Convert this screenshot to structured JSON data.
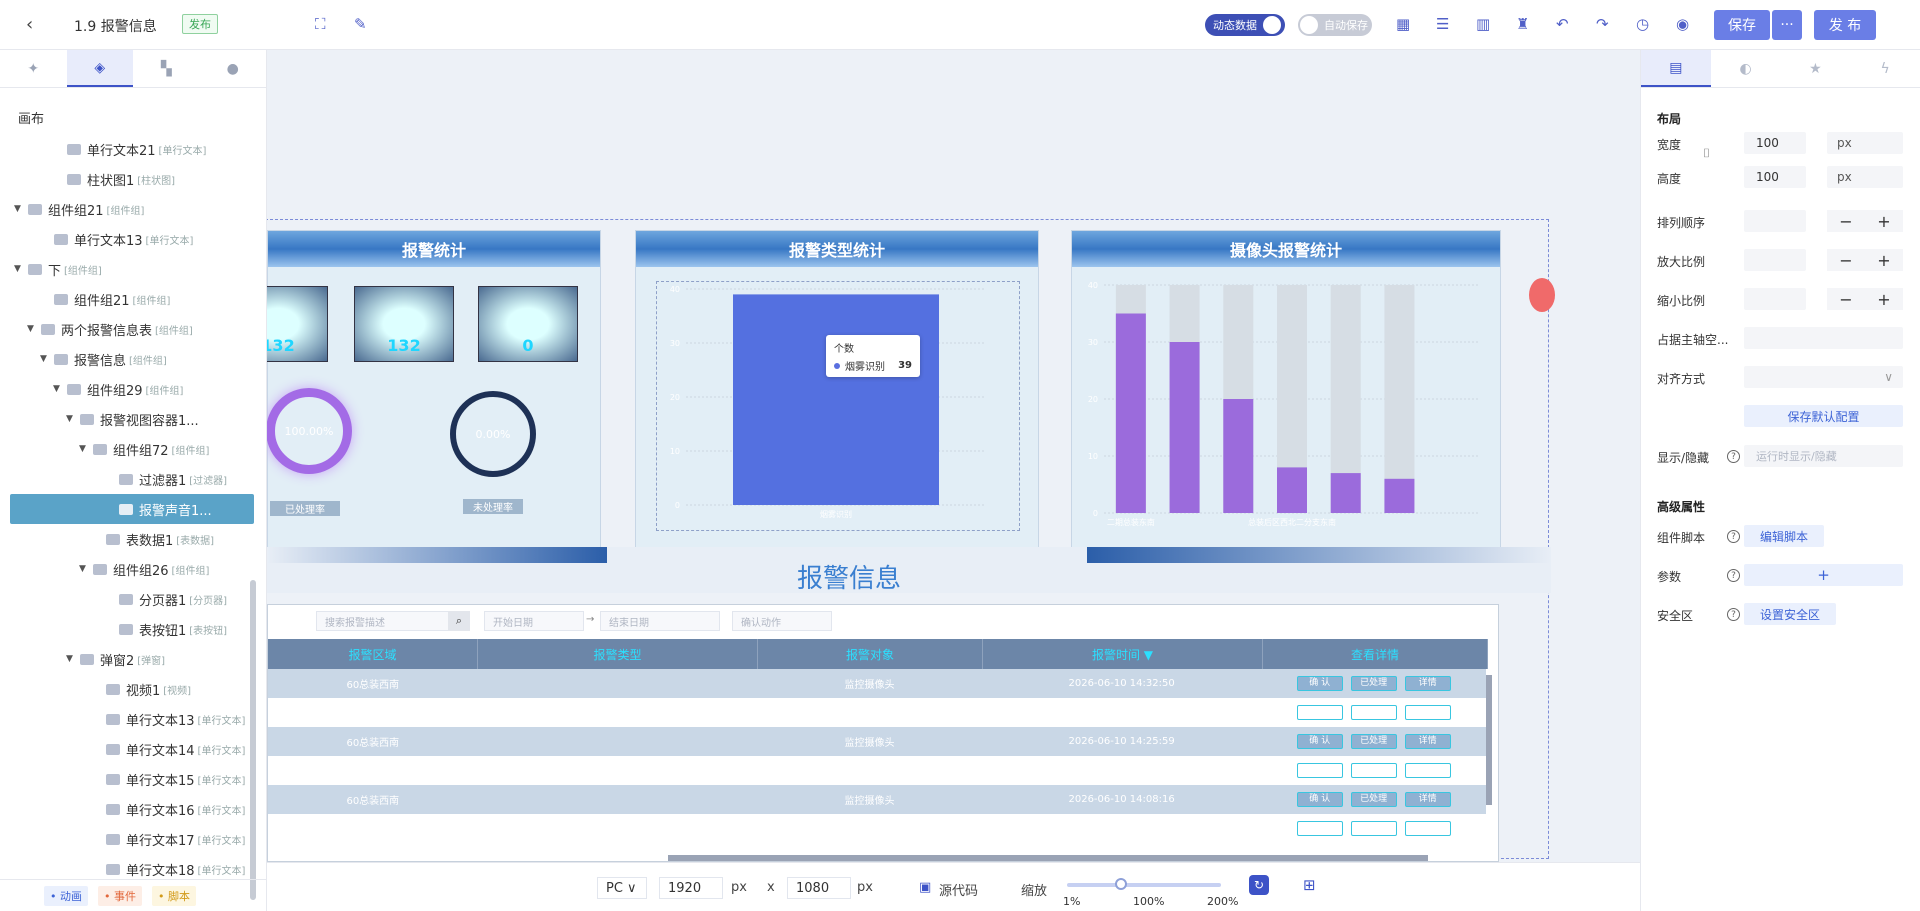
{
  "header": {
    "title": "1.9 报警信息",
    "badge": "发布",
    "dynamic_label": "动态数据",
    "autosave_label": "自动保存",
    "save": "保存",
    "more": "···",
    "publish": "发 布"
  },
  "left": {
    "canvas": "画布",
    "tree": [
      {
        "label": "单行文本21",
        "tag": "[单行文本]",
        "level": 3,
        "arrow": ""
      },
      {
        "label": "柱状图1",
        "tag": "[柱状图]",
        "level": 3,
        "arrow": ""
      },
      {
        "label": "组件组21",
        "tag": "[组件组]",
        "level": 0,
        "arrow": "▼"
      },
      {
        "label": "单行文本13",
        "tag": "[单行文本]",
        "level": 2,
        "arrow": ""
      },
      {
        "label": "下",
        "tag": "[组件组]",
        "level": 0,
        "arrow": "▼"
      },
      {
        "label": "组件组21",
        "tag": "[组件组]",
        "level": 2,
        "arrow": ""
      },
      {
        "label": "两个报警信息表",
        "tag": "[组件组]",
        "level": 1,
        "arrow": "▼"
      },
      {
        "label": "报警信息",
        "tag": "[组件组]",
        "level": 2,
        "arrow": "▼"
      },
      {
        "label": "组件组29",
        "tag": "[组件组]",
        "level": 3,
        "arrow": "▼"
      },
      {
        "label": "报警视图容器1...",
        "tag": "",
        "level": 4,
        "arrow": "▼"
      },
      {
        "label": "组件组72",
        "tag": "[组件组]",
        "level": 5,
        "arrow": "▼"
      },
      {
        "label": "过滤器1",
        "tag": "[过滤器]",
        "level": 7,
        "arrow": ""
      },
      {
        "label": "报警声音1...",
        "tag": "",
        "level": 7,
        "arrow": "",
        "selected": true
      },
      {
        "label": "表数据1",
        "tag": "[表数据]",
        "level": 6,
        "arrow": ""
      },
      {
        "label": "组件组26",
        "tag": "[组件组]",
        "level": 5,
        "arrow": "▼"
      },
      {
        "label": "分页器1",
        "tag": "[分页器]",
        "level": 7,
        "arrow": ""
      },
      {
        "label": "表按钮1",
        "tag": "[表按钮]",
        "level": 7,
        "arrow": ""
      },
      {
        "label": "弹窗2",
        "tag": "[弹窗]",
        "level": 4,
        "arrow": "▼"
      },
      {
        "label": "视频1",
        "tag": "[视频]",
        "level": 6,
        "arrow": ""
      },
      {
        "label": "单行文本13",
        "tag": "[单行文本]",
        "level": 6,
        "arrow": ""
      },
      {
        "label": "单行文本14",
        "tag": "[单行文本]",
        "level": 6,
        "arrow": ""
      },
      {
        "label": "单行文本15",
        "tag": "[单行文本]",
        "level": 6,
        "arrow": ""
      },
      {
        "label": "单行文本16",
        "tag": "[单行文本]",
        "level": 6,
        "arrow": ""
      },
      {
        "label": "单行文本17",
        "tag": "[单行文本]",
        "level": 6,
        "arrow": ""
      },
      {
        "label": "单行文本18",
        "tag": "[单行文本]",
        "level": 6,
        "arrow": ""
      }
    ],
    "footer": {
      "anim": "• 动画",
      "event": "• 事件",
      "script": "• 脚本"
    }
  },
  "stage": {
    "panel1_title": "报警统计",
    "panel2_title": "报警类型统计",
    "panel3_title": "摄像头报警统计",
    "counts": [
      "132",
      "132",
      "0"
    ],
    "ring1": "100.00%",
    "ring2": "0.00%",
    "ring1_label": "已处理率",
    "ring2_label": "未处理率",
    "tooltip_title": "个数",
    "tooltip_series": "烟雾识别",
    "tooltip_value": "39",
    "bar2_label": "烟雾识别",
    "info_title": "报警信息",
    "filter": {
      "desc": "搜索报警描述",
      "start": "开始日期",
      "arrow": "→",
      "end": "结束日期",
      "action": "确认动作"
    },
    "columns": [
      "报警区域",
      "报警类型",
      "报警对象",
      "报警时间 ▼",
      "查看详情"
    ],
    "rows": [
      {
        "area": "60总装西南",
        "obj": "监控摄像头",
        "time": "2026-06-10 14:32:50"
      },
      {
        "area": "60总装西南",
        "obj": "监控摄像头",
        "time": "2026-06-10 14:25:59"
      },
      {
        "area": "60总装西南",
        "obj": "监控摄像头",
        "time": "2026-06-10 14:08:16"
      }
    ],
    "btns": [
      "确 认",
      "已处理",
      "详情"
    ]
  },
  "chart_data": [
    {
      "type": "bar",
      "title": "报警类型统计",
      "categories": [
        "烟雾识别"
      ],
      "values": [
        39
      ],
      "ylim": [
        0,
        40
      ],
      "yticks": [
        "0",
        "10",
        "20",
        "30",
        "40"
      ]
    },
    {
      "type": "bar",
      "title": "摄像头报警统计",
      "categories": [
        "二期总装东南",
        "",
        "",
        "总装后区西北二分支东南",
        "",
        "",
        ""
      ],
      "values": [
        35,
        30,
        20,
        8,
        7,
        6
      ],
      "ylim": [
        0,
        40
      ],
      "yticks": [
        "0",
        "10",
        "20",
        "30",
        "40"
      ],
      "bar_color": "#9b6bdc",
      "bg_color": "#d6dde4"
    }
  ],
  "right": {
    "layout": "布局",
    "width": "宽度",
    "height": "高度",
    "w_val": "100",
    "h_val": "100",
    "unit": "px",
    "order": "排列顺序",
    "zoomin": "放大比例",
    "zoomout": "缩小比例",
    "axis": "占据主轴空...",
    "align": "对齐方式",
    "save_default": "保存默认配置",
    "visible": "显示/隐藏",
    "visible_ph": "运行时显示/隐藏",
    "advanced": "高级属性",
    "script": "组件脚本",
    "edit_script": "编辑脚本",
    "params": "参数",
    "plus": "+",
    "safe": "安全区",
    "set_safe": "设置安全区",
    "minus": "−"
  },
  "bottom": {
    "device": "PC ∨",
    "w": "1920",
    "h": "1080",
    "px": "px",
    "x": "x",
    "source": "源代码",
    "zoom": "缩放",
    "z1": "1%",
    "z2": "100%",
    "z3": "200%"
  }
}
